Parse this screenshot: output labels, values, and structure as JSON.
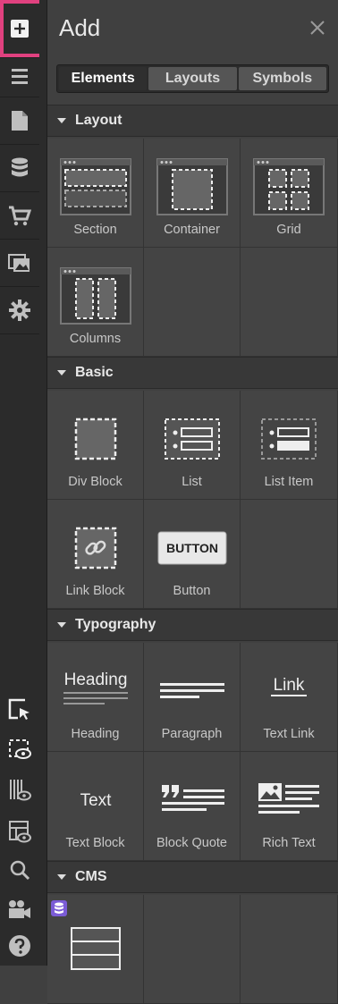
{
  "panel": {
    "title": "Add"
  },
  "tabs": [
    {
      "label": "Elements",
      "active": true
    },
    {
      "label": "Layouts",
      "active": false
    },
    {
      "label": "Symbols",
      "active": false
    }
  ],
  "sections": {
    "layout": {
      "title": "Layout",
      "items": [
        "Section",
        "Container",
        "Grid",
        "Columns"
      ]
    },
    "basic": {
      "title": "Basic",
      "items": [
        "Div Block",
        "List",
        "List Item",
        "Link Block",
        "Button"
      ]
    },
    "typography": {
      "title": "Typography",
      "items": [
        "Heading",
        "Paragraph",
        "Text Link",
        "Text Block",
        "Block Quote",
        "Rich Text"
      ]
    },
    "cms": {
      "title": "CMS"
    }
  },
  "icons": {
    "button_text": "BUTTON",
    "heading_text": "Heading",
    "link_text": "Link",
    "text_text": "Text"
  },
  "rail": [
    "plus-icon",
    "navigator-icon",
    "pages-icon",
    "cms-icon",
    "ecommerce-icon",
    "assets-icon",
    "settings-icon",
    "select-element-icon",
    "preview-icon",
    "audit-icon",
    "style-preview-icon",
    "search-icon",
    "video-icon",
    "help-icon"
  ],
  "colors": {
    "highlight": "#e0417f",
    "cms_badge": "#7b5cd6"
  }
}
